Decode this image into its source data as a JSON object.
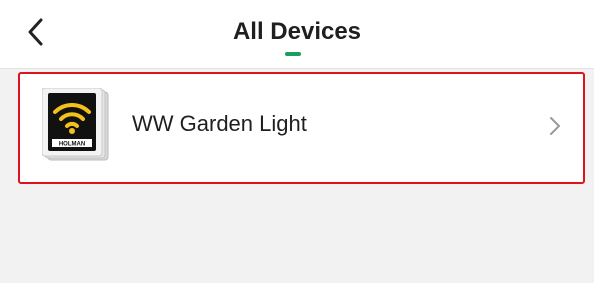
{
  "header": {
    "title": "All Devices",
    "back_icon": "chevron-left-icon",
    "underline_color": "#1a9e5c"
  },
  "devices": [
    {
      "name": "WW Garden Light",
      "thumbnail_icon": "wifi-icon",
      "brand_label": "HOLMAN",
      "chevron_icon": "chevron-right-icon",
      "highlight_color": "#e0121b"
    }
  ]
}
